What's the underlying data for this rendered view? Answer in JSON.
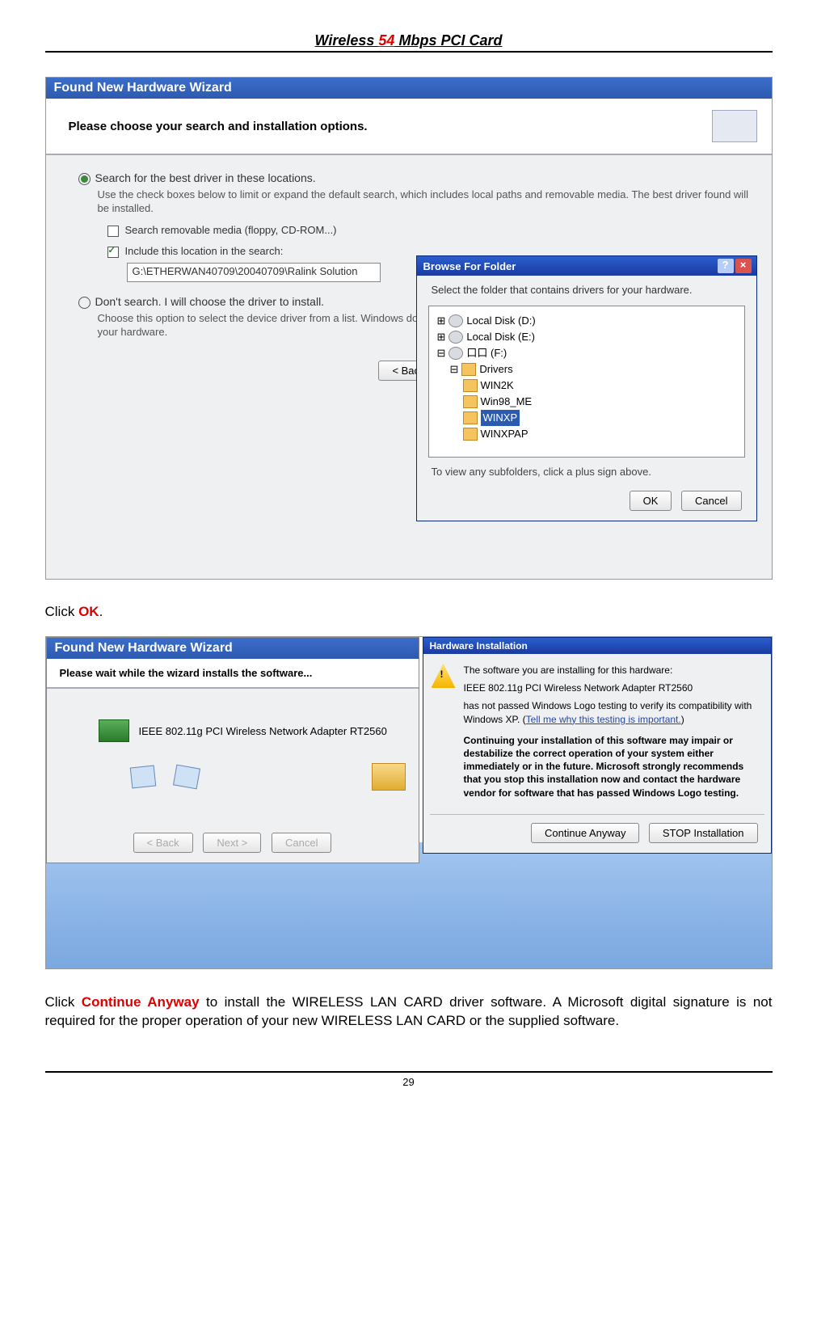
{
  "page_header": {
    "prefix": "Wireless ",
    "red": "54",
    "suffix": " Mbps PCI Card"
  },
  "fig1": {
    "title": "Found New Hardware Wizard",
    "header": "Please choose your search and installation options.",
    "opt1": "Search for the best driver in these locations.",
    "opt1_sub": "Use the check boxes below to limit or expand the default search, which includes local paths and removable media. The best driver found will be installed.",
    "chk1": "Search removable media (floppy, CD-ROM...)",
    "chk2": "Include this location in the search:",
    "path": "G:\\ETHERWAN40709\\20040709\\Ralink Solution",
    "opt2": "Don't search. I will choose the driver to install.",
    "opt2_sub": "Choose this option to select the device driver from a list. Windows does not guarantee that the driver you choose will be the best match for your hardware.",
    "back": "< Back",
    "bff": {
      "title": "Browse For Folder",
      "msg": "Select the folder that contains drivers for your hardware.",
      "nodes": {
        "d": "Local Disk (D:)",
        "e": "Local Disk (E:)",
        "f": "口口 (F:)",
        "drv": "Drivers",
        "w2k": "WIN2K",
        "w98": "Win98_ME",
        "wxp": "WINXP",
        "wxpap": "WINXPAP"
      },
      "hint": "To view any subfolders, click a plus sign above.",
      "ok": "OK",
      "cancel": "Cancel"
    }
  },
  "click_ok": {
    "pre": "Click ",
    "red": "OK",
    "post": "."
  },
  "fig2": {
    "wiz_title": "Found New Hardware Wizard",
    "wiz_header": "Please wait while the wizard installs the software...",
    "device": "IEEE 802.11g PCI Wireless Network Adapter RT2560",
    "back": "< Back",
    "next": "Next >",
    "cancel": "Cancel",
    "hw": {
      "title": "Hardware Installation",
      "l1": "The software you are installing for this hardware:",
      "l2": "IEEE 802.11g PCI Wireless Network Adapter RT2560",
      "l3a": "has not passed Windows Logo testing to verify its compatibility with Windows XP. (",
      "l3link": "Tell me why this testing is important.",
      "l3b": ")",
      "bold": "Continuing your installation of this software may impair or destabilize the correct operation of your system either immediately or in the future. Microsoft strongly recommends that you stop this installation now and contact the hardware vendor for software that has passed Windows Logo testing.",
      "cont": "Continue Anyway",
      "stop": "STOP Installation"
    }
  },
  "inst": {
    "pre": "Click ",
    "red": "Continue Anyway",
    "post": " to install the WIRELESS LAN CARD driver software.  A Microsoft digital signature is not required for the proper operation of your new WIRELESS LAN CARD or the supplied software."
  },
  "page_number": "29"
}
